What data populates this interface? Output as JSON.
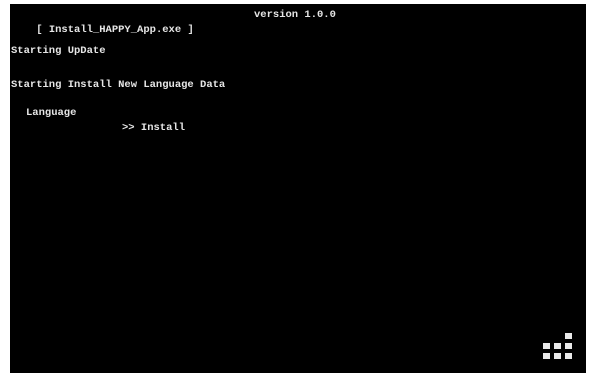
{
  "window": {
    "title": "[ Install_HAPPY_App.exe ]",
    "version": "version 1.0.0"
  },
  "log": {
    "line1": "Starting UpDate",
    "line2": "Starting Install New Language Data",
    "language_label": "Language",
    "language_status": ">> Install"
  },
  "colors": {
    "background": "#000000",
    "text": "#e6e6e6",
    "loader": "#e9e9e9"
  },
  "icons": {
    "loader": "loading-dots-icon"
  }
}
